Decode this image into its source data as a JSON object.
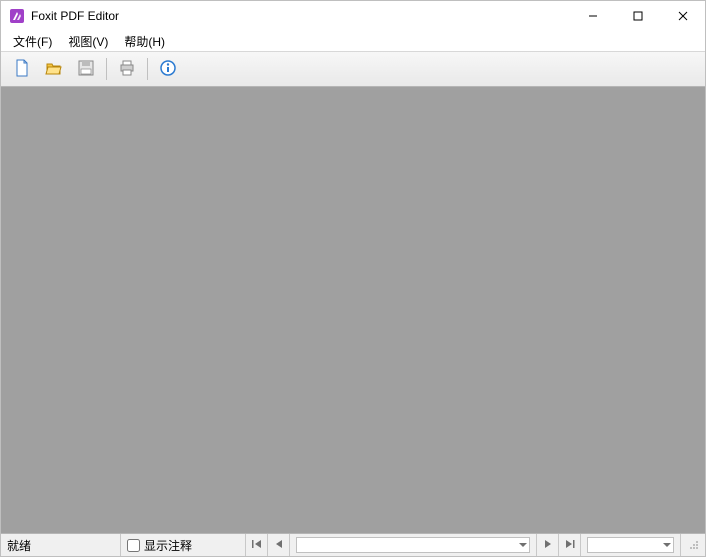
{
  "titlebar": {
    "title": "Foxit PDF Editor"
  },
  "menu": {
    "file": "文件(F)",
    "view": "视图(V)",
    "help": "帮助(H)"
  },
  "toolbar": {
    "new": "new-file-icon",
    "open": "open-folder-icon",
    "save": "save-icon",
    "print": "print-icon",
    "about": "info-icon"
  },
  "statusbar": {
    "ready": "就绪",
    "show_annotations": "显示注释"
  }
}
